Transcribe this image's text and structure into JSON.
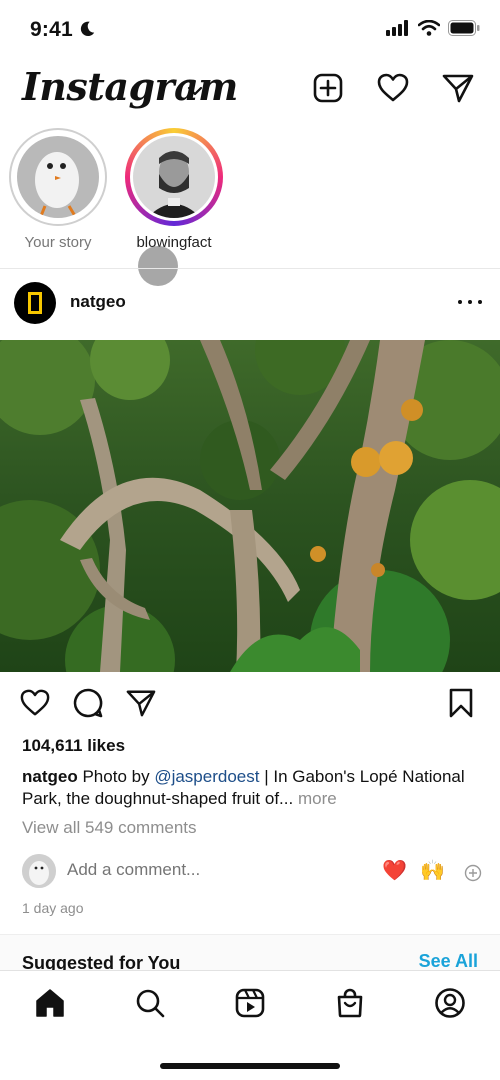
{
  "status_bar": {
    "time": "9:41",
    "icons": [
      "moon-icon",
      "signal-icon",
      "wifi-icon",
      "battery-icon"
    ]
  },
  "header": {
    "logo_text": "Instagram",
    "icons": [
      "chevron-down-icon",
      "new-post-icon",
      "heart-icon",
      "direct-message-icon"
    ]
  },
  "stories": [
    {
      "label": "Your story",
      "seen": true
    },
    {
      "label": "blowingfact",
      "seen": false
    }
  ],
  "post": {
    "username": "natgeo",
    "likes": "104,611 likes",
    "caption": {
      "user": "natgeo",
      "prefix": "Photo by",
      "mention": "@jasperdoest",
      "text": "| In Gabon's Lopé National Park, the doughnut-shaped fruit of...",
      "more": "more"
    },
    "view_comments": "View all 549 comments",
    "comment_placeholder": "Add a comment...",
    "quick_reactions": [
      "❤️",
      "🙌"
    ],
    "time_ago": "1 day ago"
  },
  "suggested": {
    "title": "Suggested for You",
    "see_all": "See All"
  },
  "tab_bar": {
    "tabs": [
      "home-icon",
      "search-icon",
      "reels-icon",
      "shop-icon",
      "profile-icon"
    ]
  },
  "colors": {
    "link": "#1aa3d9",
    "mention": "#1d4e89",
    "secondary_text": "#8e8e8e",
    "natgeo_yellow": "#f7c700",
    "story_gradient": [
      "#f9ce34",
      "#ee2a7b",
      "#6228d7"
    ]
  }
}
